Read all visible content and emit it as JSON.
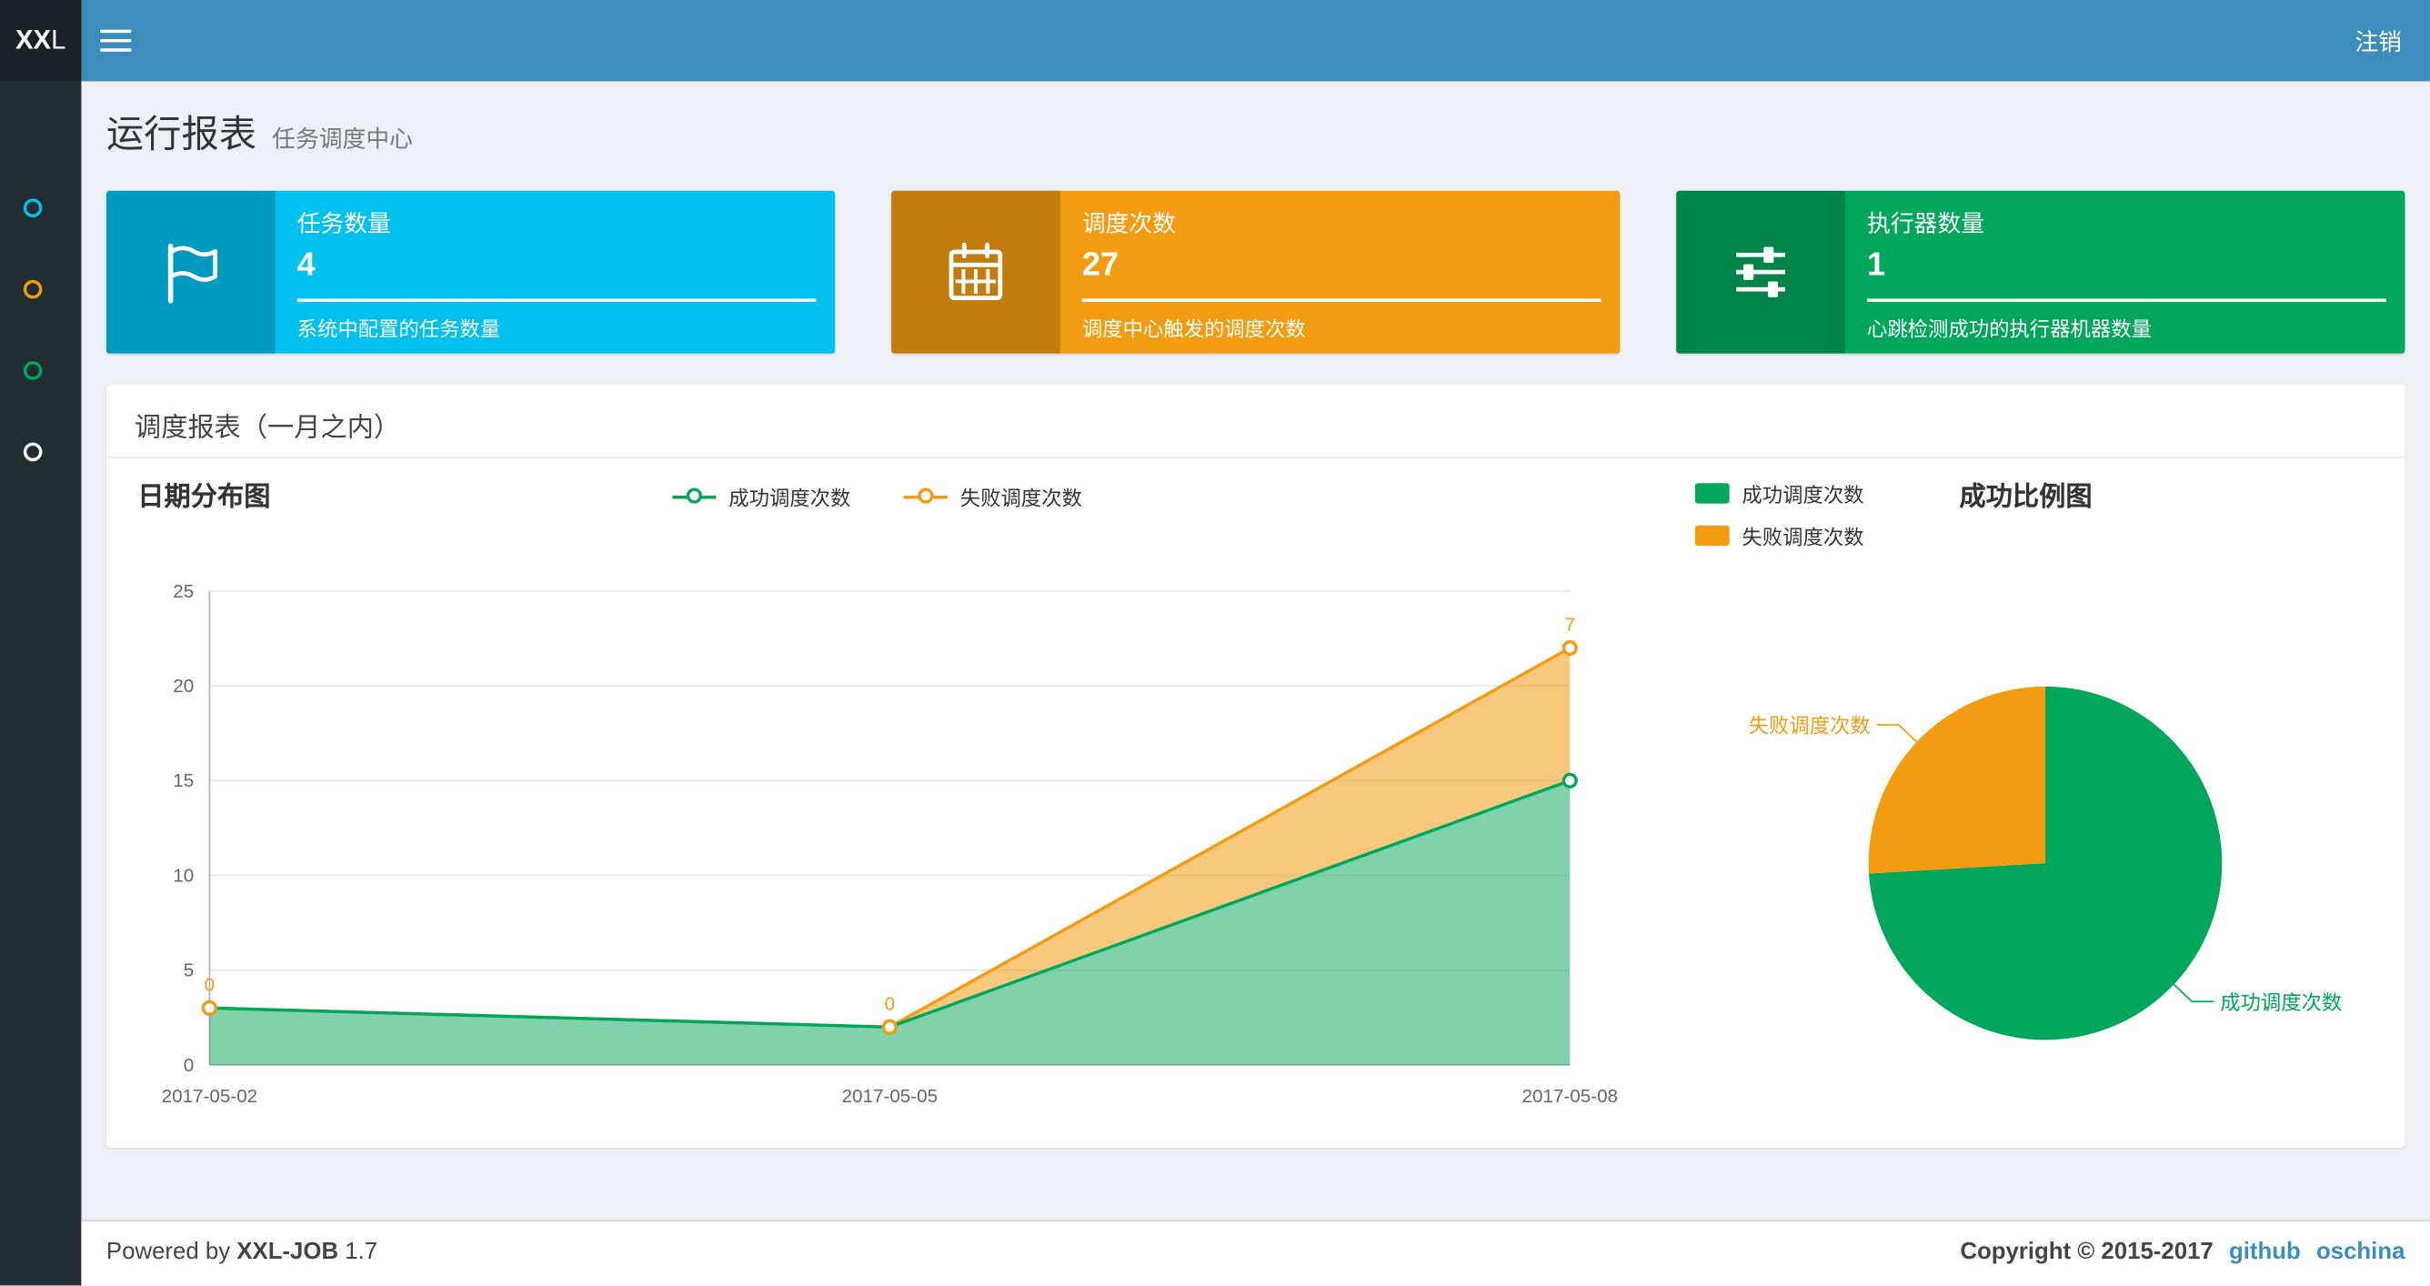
{
  "navbar": {
    "logo_bold": "XX",
    "logo_rest": "L",
    "logout_label": "注销"
  },
  "sidebar": {
    "items": [
      {
        "icon": "circle-outline-icon",
        "color": "#00c0ef"
      },
      {
        "icon": "circle-outline-icon",
        "color": "#f39c12"
      },
      {
        "icon": "circle-outline-icon",
        "color": "#00a65a"
      },
      {
        "icon": "circle-outline-icon",
        "color": "#ffffff"
      }
    ]
  },
  "page": {
    "title": "运行报表",
    "subtitle": "任务调度中心"
  },
  "info_boxes": [
    {
      "title": "任务数量",
      "number": "4",
      "desc": "系统中配置的任务数量",
      "color": "#00c0ef",
      "icon": "flag-icon"
    },
    {
      "title": "调度次数",
      "number": "27",
      "desc": "调度中心触发的调度次数",
      "color": "#f39c12",
      "icon": "calendar-icon"
    },
    {
      "title": "执行器数量",
      "number": "1",
      "desc": "心跳检测成功的执行器机器数量",
      "color": "#00a65a",
      "icon": "sliders-icon"
    }
  ],
  "panel": {
    "title": "调度报表（一月之内）"
  },
  "chart_data": [
    {
      "type": "area",
      "title": "日期分布图",
      "x": [
        "2017-05-02",
        "2017-05-05",
        "2017-05-08"
      ],
      "series": [
        {
          "name": "成功调度次数",
          "values": [
            3,
            2,
            15
          ],
          "color": "#00a65a"
        },
        {
          "name": "失败调度次数",
          "values": [
            0,
            0,
            7
          ],
          "color": "#f39c12"
        }
      ],
      "stacked": true,
      "point_labels": [
        "0",
        "0",
        "7"
      ],
      "ylim": [
        0,
        25
      ],
      "yticks": [
        0,
        5,
        10,
        15,
        20,
        25
      ],
      "legend_position": "top-center",
      "grid": true
    },
    {
      "type": "pie",
      "title": "成功比例图",
      "slices": [
        {
          "name": "成功调度次数",
          "value": 20,
          "color": "#00a65a"
        },
        {
          "name": "失败调度次数",
          "value": 7,
          "color": "#f39c12"
        }
      ],
      "legend_position": "top-left"
    }
  ],
  "footer": {
    "powered_by": "Powered by",
    "brand": "XXL-JOB",
    "version": "1.7",
    "copyright": "Copyright © 2015-2017",
    "link_github": "github",
    "link_oschina": "oschina"
  }
}
